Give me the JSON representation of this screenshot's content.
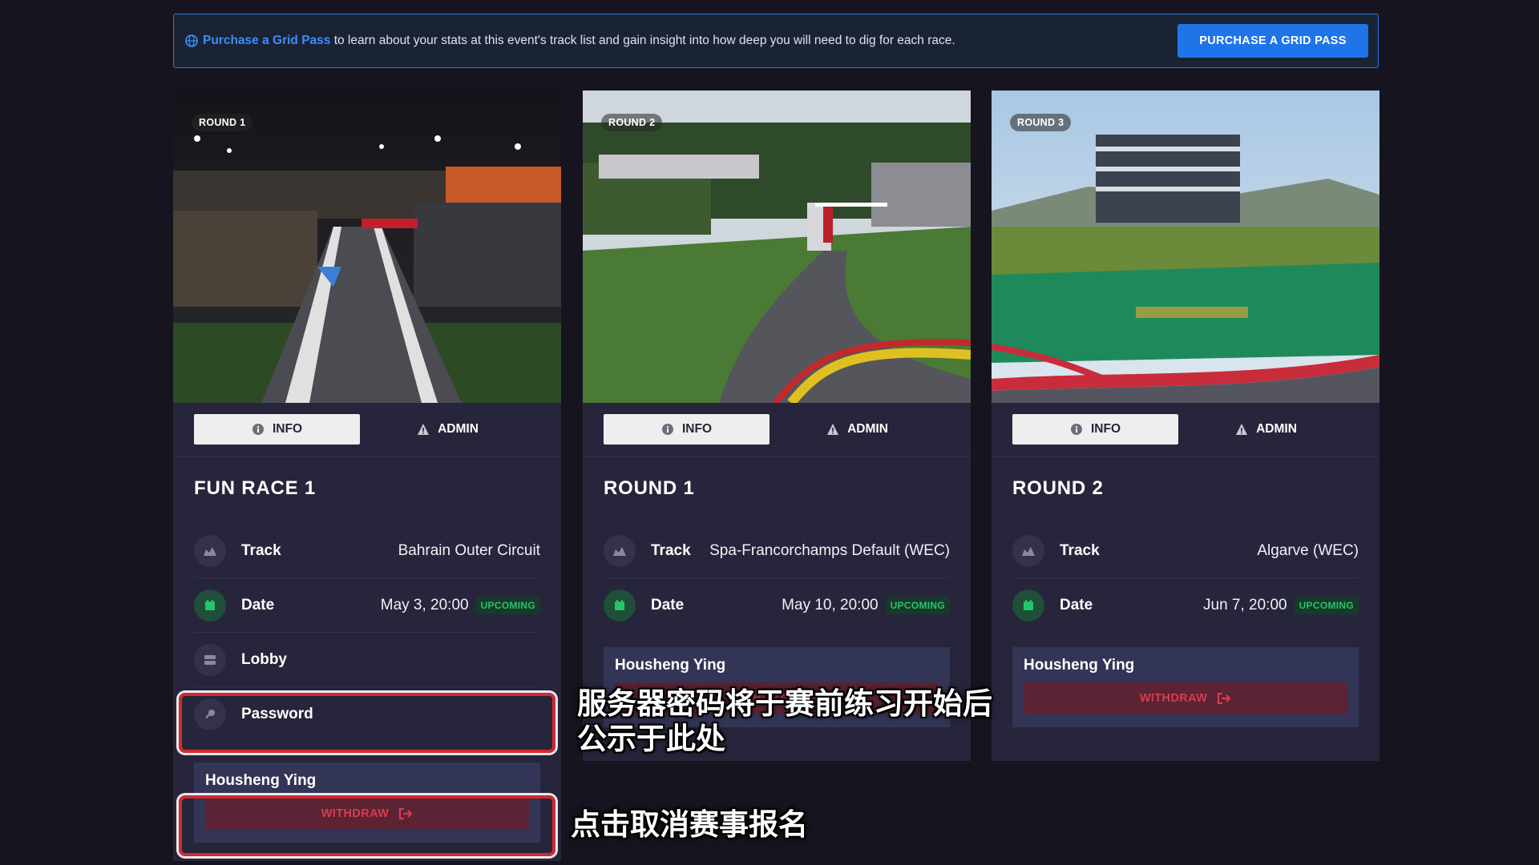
{
  "banner": {
    "link_text": "Purchase a Grid Pass",
    "message": " to learn about your stats at this event's track list and gain insight into how deep you will need to dig for each race.",
    "button_label": "PURCHASE A GRID PASS"
  },
  "tabs": {
    "info": "INFO",
    "admin": "ADMIN"
  },
  "labels": {
    "track": "Track",
    "date": "Date",
    "lobby": "Lobby",
    "password": "Password",
    "upcoming": "UPCOMING",
    "withdraw": "WITHDRAW"
  },
  "cards": [
    {
      "round_badge": "ROUND 1",
      "title": "FUN RACE 1",
      "track": "Bahrain Outer Circuit",
      "date": "May 3, 20:00",
      "participant": "Housheng Ying"
    },
    {
      "round_badge": "ROUND 2",
      "title": "ROUND 1",
      "track": "Spa-Francorchamps Default (WEC)",
      "date": "May 10, 20:00",
      "participant": "Housheng Ying"
    },
    {
      "round_badge": "ROUND 3",
      "title": "ROUND 2",
      "track": "Algarve (WEC)",
      "date": "Jun 7, 20:00",
      "participant": "Housheng Ying"
    }
  ],
  "annotations": {
    "password_note_line1": "服务器密码将于赛前练习开始后",
    "password_note_line2": "公示于此处",
    "withdraw_note": "点击取消赛事报名"
  },
  "colors": {
    "background": "#15141f",
    "card": "#26253b",
    "accent_blue": "#1f74e8",
    "status_green": "#27c46b",
    "withdraw_red": "#d53d4f",
    "highlight_red": "#d22a30"
  }
}
